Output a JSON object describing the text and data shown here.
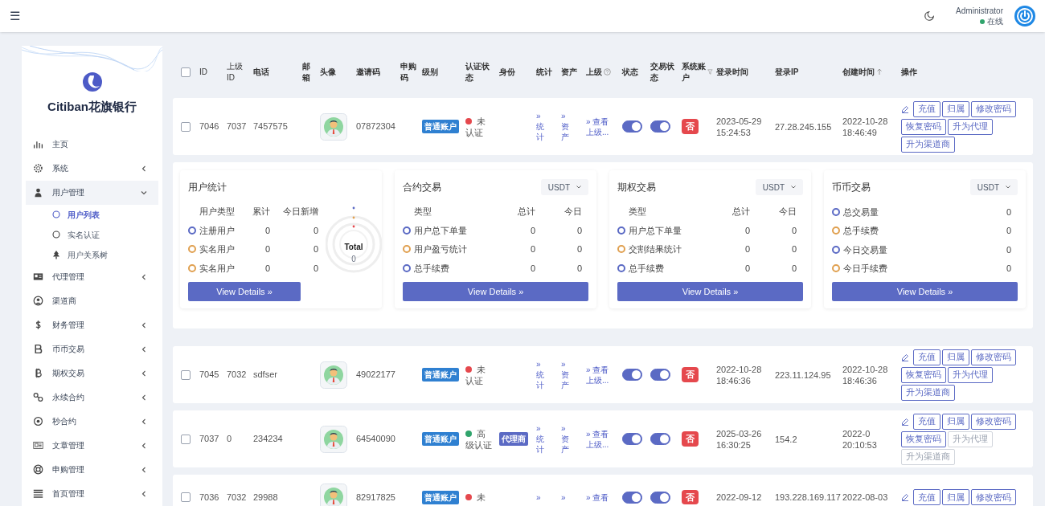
{
  "topbar": {
    "menu_glyph": "☰",
    "user": "Administrator",
    "online": "在线"
  },
  "sidebar": {
    "brand": "Citiban花旗银行",
    "items": [
      {
        "label": "主页",
        "kind": "link"
      },
      {
        "label": "系统",
        "kind": "group",
        "expanded": false
      },
      {
        "label": "用户管理",
        "kind": "group",
        "expanded": true,
        "children": [
          {
            "label": "用户列表",
            "selected": true
          },
          {
            "label": "实名认证",
            "selected": false
          },
          {
            "label": "用户关系树",
            "selected": false
          }
        ]
      },
      {
        "label": "代理管理",
        "kind": "group",
        "expanded": false
      },
      {
        "label": "渠道商",
        "kind": "link"
      },
      {
        "label": "财务管理",
        "kind": "group",
        "expanded": false
      },
      {
        "label": "币币交易",
        "kind": "group",
        "expanded": false
      },
      {
        "label": "期权交易",
        "kind": "group",
        "expanded": false
      },
      {
        "label": "永续合约",
        "kind": "group",
        "expanded": false
      },
      {
        "label": "秒合约",
        "kind": "group",
        "expanded": false
      },
      {
        "label": "文章管理",
        "kind": "group",
        "expanded": false
      },
      {
        "label": "申购管理",
        "kind": "group",
        "expanded": false
      },
      {
        "label": "首页管理",
        "kind": "group",
        "expanded": false
      }
    ]
  },
  "table": {
    "header_checkbox": {
      "checked": false
    },
    "columns": [
      {
        "label": "ID"
      },
      {
        "label": "上级ID"
      },
      {
        "label": "电话"
      },
      {
        "label": "邮箱"
      },
      {
        "label": "头像"
      },
      {
        "label": "邀请码"
      },
      {
        "label": "申购码"
      },
      {
        "label": "级别"
      },
      {
        "label": "认证状态"
      },
      {
        "label": "身份"
      },
      {
        "label": "统计"
      },
      {
        "label": "资产"
      },
      {
        "label": "上级"
      },
      {
        "label": "状态"
      },
      {
        "label": "交易状态"
      },
      {
        "label": "系统账户"
      },
      {
        "label": "登录时间"
      },
      {
        "label": "登录IP"
      },
      {
        "label": "创建时间",
        "sort_ascending": true
      },
      {
        "label": "操作"
      }
    ],
    "rows": [
      {
        "checked": false,
        "id": "7046",
        "parent_id": "7037",
        "phone": "7457575",
        "invite_code": "07872304",
        "level": "普通账户",
        "auth": "未认证",
        "color": "#e5484d",
        "stats": "» 统计",
        "assets": "» 资产",
        "parent_link": "» 查看上级...",
        "status_on": true,
        "trade_on": true,
        "system": "否",
        "login_time": "2023-05-29 15:24:53",
        "ip": "27.28.245.155",
        "created": "2022-10-28 18:46:49",
        "actions": [
          {
            "label": "充值",
            "disabled": false
          },
          {
            "label": "归属",
            "disabled": false
          },
          {
            "label": "修改密码",
            "disabled": false
          },
          {
            "label": "恢复密码",
            "disabled": false
          },
          {
            "label": "升为代理",
            "disabled": false
          },
          {
            "label": "升为渠道商",
            "disabled": false
          }
        ]
      },
      {
        "stats_panel": true
      },
      {
        "checked": false,
        "id": "7045",
        "parent_id": "7032",
        "phone": "sdfser",
        "invite_code": "49022177",
        "level": "普通账户",
        "auth": "未认证",
        "color": "#e5484d",
        "stats": "» 统计",
        "assets": "» 资产",
        "parent_link": "» 查看上级...",
        "status_on": true,
        "trade_on": true,
        "system": "否",
        "login_time": "2022-10-28 18:46:36",
        "ip": "223.11.124.95",
        "created": "2022-10-28 18:46:36",
        "actions": [
          {
            "label": "充值",
            "disabled": false
          },
          {
            "label": "归属",
            "disabled": false
          },
          {
            "label": "修改密码",
            "disabled": false
          },
          {
            "label": "恢复密码",
            "disabled": false
          },
          {
            "label": "升为代理",
            "disabled": false
          },
          {
            "label": "升为渠道商",
            "disabled": false
          }
        ]
      },
      {
        "checked": false,
        "id": "7037",
        "parent_id": "0",
        "phone": "234234",
        "invite_code": "64540090",
        "level": "普通账户",
        "auth": "高级认证",
        "color": "#30a46c",
        "identity": "代理商",
        "stats": "» 统计",
        "assets": "» 资产",
        "parent_link": "» 查看上级...",
        "status_on": true,
        "trade_on": true,
        "system": "否",
        "login_time": "2025-03-26 16:30:25",
        "ip": "154.2",
        "created": "2022-0 20:10:53",
        "actions": [
          {
            "label": "充值",
            "disabled": false
          },
          {
            "label": "归属",
            "disabled": false
          },
          {
            "label": "修改密码",
            "disabled": false
          },
          {
            "label": "恢复密码",
            "disabled": false
          },
          {
            "label": "升为代理",
            "disabled": true
          },
          {
            "label": "升为渠道商",
            "disabled": true
          }
        ]
      },
      {
        "checked": false,
        "id": "7036",
        "parent_id": "7032",
        "phone": "29988",
        "invite_code": "82917825",
        "level": "普通账户",
        "auth": "未",
        "color": "#e5484d",
        "stats": "»",
        "assets": "»",
        "parent_link": "» 查看",
        "status_on": true,
        "trade_on": true,
        "system": "否",
        "login_time": "2022-09-12",
        "ip": "193.228.169.117",
        "created": "2022-08-03",
        "actions": [
          {
            "label": "充值",
            "disabled": false
          },
          {
            "label": "归属",
            "disabled": false
          },
          {
            "label": "修改密码",
            "disabled": false
          }
        ]
      }
    ]
  },
  "stats": [
    {
      "kind": "users",
      "title": "用户统计",
      "headers": [
        "用户类型",
        "累计",
        "今日新增"
      ],
      "rows": [
        {
          "label": "注册用户",
          "color": "#5b6ac4",
          "values": [
            "0",
            "0"
          ]
        },
        {
          "label": "实名用户",
          "color": "#e0a050",
          "values": [
            "0",
            "0"
          ]
        },
        {
          "label": "实名用户",
          "color": "#e0a050",
          "values": [
            "0",
            "0"
          ]
        }
      ],
      "total_label": "Total",
      "total_value": "0",
      "button": "View Details »"
    },
    {
      "kind": "trade",
      "title": "合约交易",
      "currency": "USDT",
      "headers": [
        "类型",
        "总计",
        "今日"
      ],
      "rows": [
        {
          "label": "用户总下单量",
          "color": "#5b6ac4",
          "values": [
            "0",
            "0"
          ]
        },
        {
          "label": "用户盈亏统计",
          "color": "#e0a050",
          "values": [
            "0",
            "0"
          ]
        },
        {
          "label": "总手续费",
          "color": "#5b6ac4",
          "values": [
            "0",
            "0"
          ]
        }
      ],
      "button": "View Details »"
    },
    {
      "kind": "trade",
      "title": "期权交易",
      "currency": "USDT",
      "headers": [
        "类型",
        "总计",
        "今日"
      ],
      "rows": [
        {
          "label": "用户总下单量",
          "color": "#5b6ac4",
          "values": [
            "0",
            "0"
          ]
        },
        {
          "label": "交割结果统计",
          "color": "#e0a050",
          "values": [
            "0",
            "0"
          ]
        },
        {
          "label": "总手续费",
          "color": "#5b6ac4",
          "values": [
            "0",
            "0"
          ]
        }
      ],
      "button": "View Details »"
    },
    {
      "kind": "trade",
      "title": "币币交易",
      "currency": "USDT",
      "rows": [
        {
          "label": "总交易量",
          "color": "#5b6ac4",
          "values": [
            "0"
          ]
        },
        {
          "label": "总手续费",
          "color": "#e0a050",
          "values": [
            "0"
          ]
        },
        {
          "label": "今日交易量",
          "color": "#5b6ac4",
          "values": [
            "0"
          ]
        },
        {
          "label": "今日手续费",
          "color": "#e0a050",
          "values": [
            "0"
          ]
        }
      ],
      "button": "View Details »"
    }
  ]
}
